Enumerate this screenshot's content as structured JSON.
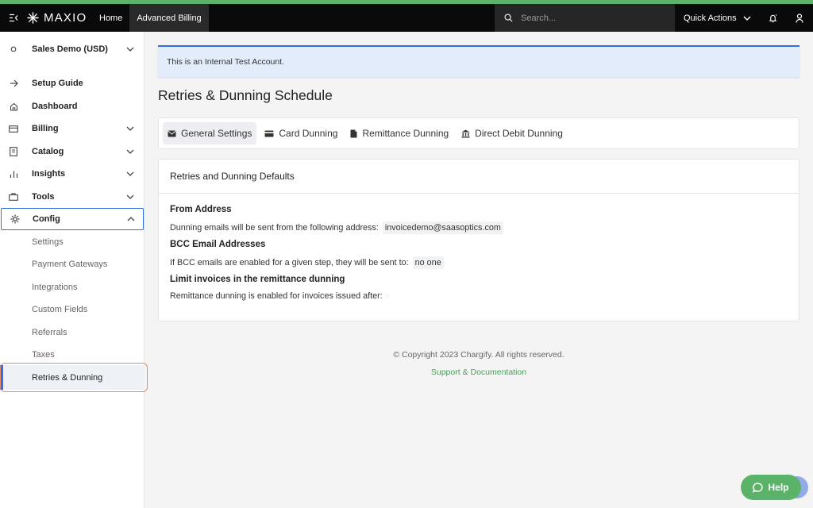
{
  "topbar": {
    "logo_text": "MAXIO",
    "nav": [
      {
        "label": "Home"
      },
      {
        "label": "Advanced Billing"
      }
    ],
    "search_placeholder": "Search...",
    "quick_actions_label": "Quick Actions",
    "accent_color": "#5bb36a"
  },
  "sidebar": {
    "account": "Sales Demo (USD)",
    "items": [
      {
        "label": "Setup Guide",
        "icon": "arrow-right-icon"
      },
      {
        "label": "Dashboard",
        "icon": "home-icon"
      },
      {
        "label": "Billing",
        "icon": "card-icon"
      },
      {
        "label": "Catalog",
        "icon": "book-icon"
      },
      {
        "label": "Insights",
        "icon": "bar-chart-icon"
      },
      {
        "label": "Tools",
        "icon": "briefcase-icon"
      },
      {
        "label": "Config",
        "icon": "gear-icon"
      }
    ],
    "config_children": [
      {
        "label": "Settings"
      },
      {
        "label": "Payment Gateways"
      },
      {
        "label": "Integrations"
      },
      {
        "label": "Custom Fields"
      },
      {
        "label": "Referrals"
      },
      {
        "label": "Taxes"
      },
      {
        "label": "Retries & Dunning"
      }
    ]
  },
  "banner": {
    "text": "This is an Internal Test Account."
  },
  "page": {
    "title": "Retries & Dunning Schedule"
  },
  "tabs": [
    {
      "label": "General Settings",
      "icon": "envelope-icon"
    },
    {
      "label": "Card Dunning",
      "icon": "credit-card-icon"
    },
    {
      "label": "Remittance Dunning",
      "icon": "document-icon"
    },
    {
      "label": "Direct Debit Dunning",
      "icon": "bank-icon"
    }
  ],
  "card": {
    "header": "Retries and Dunning Defaults",
    "from_title": "From Address",
    "from_text": "Dunning emails will be sent from the following address:",
    "from_value": "invoicedemo@saasoptics.com",
    "bcc_title": "BCC Email Addresses",
    "bcc_text": "If BCC emails are enabled for a given step, they will be sent to:",
    "bcc_value": "no one",
    "limit_title": "Limit invoices in the remittance dunning",
    "limit_text": "Remittance dunning is enabled for invoices issued after:"
  },
  "footer": {
    "copyright": "© Copyright 2023 Chargify. All rights reserved.",
    "link": "Support & Documentation"
  },
  "help": {
    "label": "Help"
  }
}
